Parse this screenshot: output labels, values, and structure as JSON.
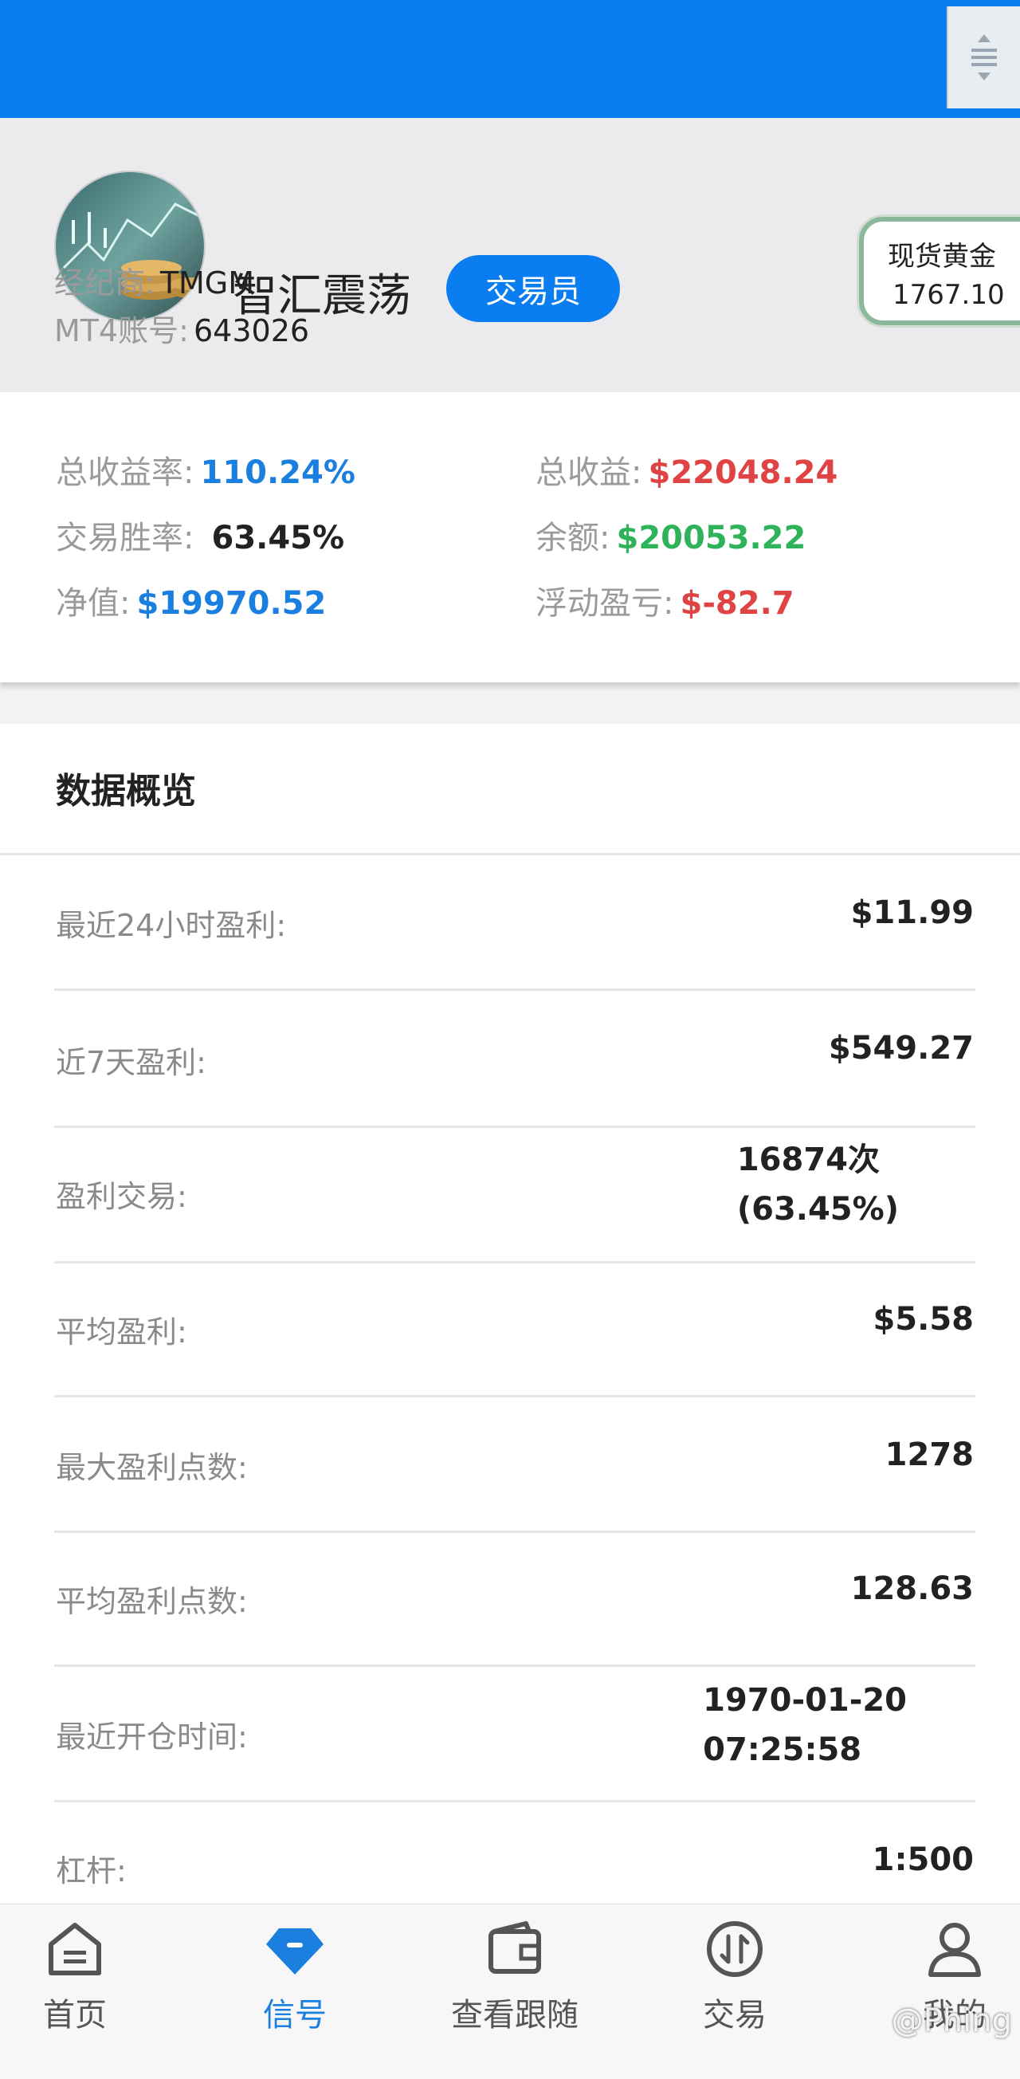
{
  "profile": {
    "name": "智汇震荡",
    "role": "交易员",
    "broker_label": "经纪商:",
    "broker_value": "TMGM",
    "account_label": "MT4账号:",
    "account_value": "643026"
  },
  "gold": {
    "label": "现货黄金",
    "price": "1767.10"
  },
  "stats": {
    "total_return_rate_label": "总收益率:",
    "total_return_rate": "110.24%",
    "total_profit_label": "总收益:",
    "total_profit": "$22048.24",
    "win_rate_label": "交易胜率:",
    "win_rate": "63.45%",
    "balance_label": "余额:",
    "balance": "$20053.22",
    "equity_label": "净值:",
    "equity": "$19970.52",
    "floating_label": "浮动盈亏:",
    "floating": "$-82.7"
  },
  "overview": {
    "title": "数据概览",
    "rows": [
      {
        "label": "最近24小时盈利:",
        "value": "$11.99"
      },
      {
        "label": "近7天盈利:",
        "value": "$549.27"
      },
      {
        "label": "盈利交易:",
        "value": "16874次",
        "value2": "(63.45%)"
      },
      {
        "label": "平均盈利:",
        "value": "$5.58"
      },
      {
        "label": "最大盈利点数:",
        "value": "1278"
      },
      {
        "label": "平均盈利点数:",
        "value": "128.63"
      },
      {
        "label": "最近开仓时间:",
        "value": "1970-01-20",
        "value2": "07:25:58"
      },
      {
        "label": "杠杆:",
        "value": "1:500"
      }
    ]
  },
  "nav": {
    "items": [
      {
        "label": "首页",
        "icon": "home-icon"
      },
      {
        "label": "信号",
        "icon": "diamond-icon"
      },
      {
        "label": "查看跟随",
        "icon": "wallet-icon"
      },
      {
        "label": "交易",
        "icon": "trade-arrows-icon"
      },
      {
        "label": "我的",
        "icon": "user-icon"
      }
    ],
    "active_index": 1
  },
  "watermark": "@Phing",
  "colors": {
    "accent_blue": "#0a7df0",
    "profit_red": "#e04343",
    "balance_green": "#2fb35a"
  }
}
